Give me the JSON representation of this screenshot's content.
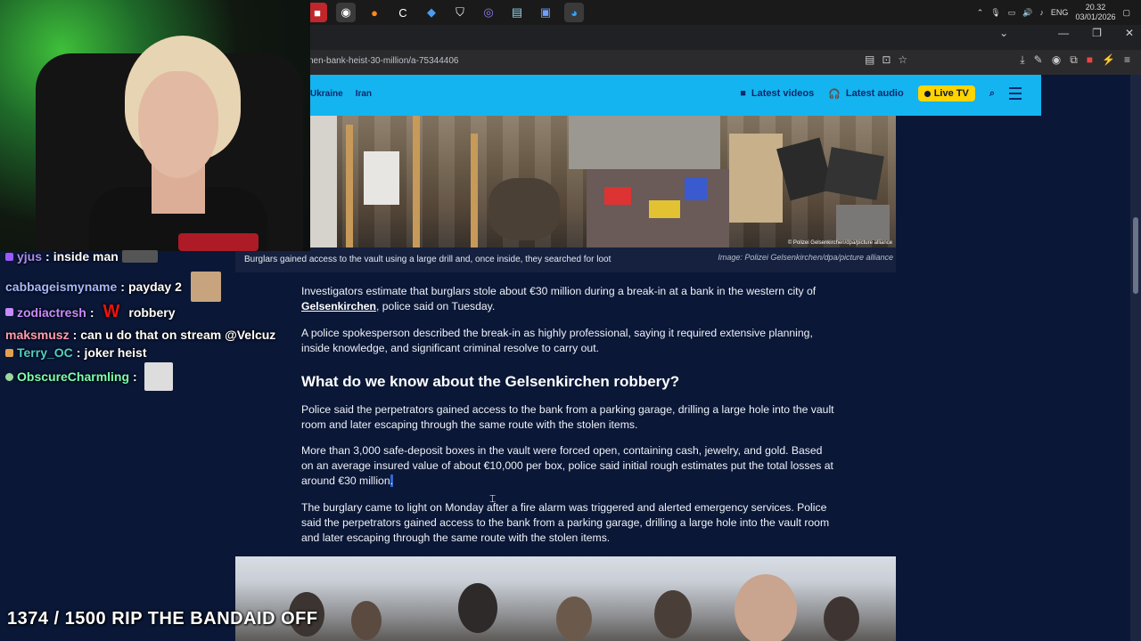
{
  "taskbar": {
    "icons": [
      "app-icon",
      "firefox-icon",
      "ccleaner-icon",
      "vpn-icon",
      "shield-icon",
      "discord-icon",
      "files-icon",
      "app-icon",
      "browser-icon"
    ],
    "lang": "ENG",
    "time": "20.32",
    "date": "03/01/2026"
  },
  "browser": {
    "url": "nen-bank-heist-30-million/a-75344406"
  },
  "site_nav": {
    "links": [
      "Ukraine",
      "Iran"
    ],
    "latest_videos": "Latest videos",
    "latest_audio": "Latest audio",
    "live_tv": "Live TV"
  },
  "hero": {
    "credit_overlay": "© Polizei Gelsenkirchen/dpa/picture alliance",
    "caption": "Burglars gained access to the vault using a large drill and, once inside, they searched for loot",
    "credit": "Image: Polizei Gelsenkirchen/dpa/picture alliance"
  },
  "article": {
    "p1_before": "Investigators estimate that burglars stole about €30 million during a break-in at a bank in the western city of ",
    "p1_link": "Gelsenkirchen",
    "p1_after": ", police said on Tuesday.",
    "p2": "A police spokesperson described the break-in as highly professional, saying it required extensive planning, inside knowledge, and significant criminal resolve to carry out.",
    "heading": "What do we know about the Gelsenkirchen robbery?",
    "p3": "Police said the perpetrators gained access to the bank from a parking garage, drilling a large hole into the vault room and later escaping through the same route with the stolen items.",
    "p4": "More than 3,000 safe-deposit boxes in the vault were forced open, containing cash, jewelry, and gold. Based on an average insured value of about €10,000 per box, police said initial rough estimates put the total losses at around €30 million",
    "p4_selected": ".",
    "p5": "The burglary came to light on Monday after a fire alarm was triggered and alerted emergency services. Police said the perpetrators gained access to the bank from a parking garage, drilling a large hole into the vault room and later escaping through the same route with the stolen items."
  },
  "chat": [
    {
      "user": "yjus",
      "msg": "inside man",
      "color": "#a98cf0"
    },
    {
      "user": "cabbageismyname",
      "msg": "payday 2",
      "color": "#a7b8ff"
    },
    {
      "user": "zodiactresh",
      "msg": "robbery",
      "color": "#c78bff",
      "emote": "W"
    },
    {
      "user": "maksmusz",
      "msg": "can u do that on stream @Velcuz",
      "color": "#ff9bb0"
    },
    {
      "user": "Terry_OC",
      "msg": "joker heist",
      "color": "#4fd1c5"
    },
    {
      "user": "ObscureCharmling",
      "msg": "",
      "color": "#7dffb0"
    }
  ],
  "overlay": {
    "goal": "1374 / 1500 RIP THE BANDAID OFF"
  }
}
